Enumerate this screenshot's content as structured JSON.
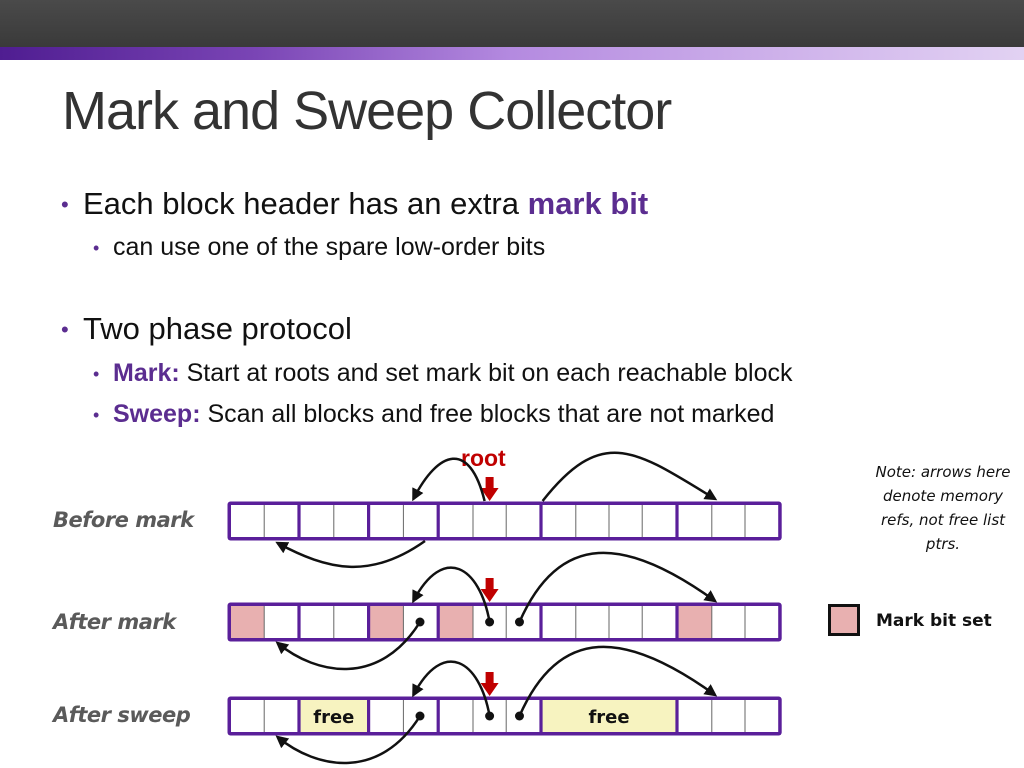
{
  "slide": {
    "title": "Mark and Sweep Collector",
    "bullets": [
      {
        "level": 1,
        "parts": [
          {
            "text": "Each block header has an extra ",
            "highlight": false
          },
          {
            "text": "mark bit",
            "highlight": true
          }
        ]
      },
      {
        "level": 2,
        "parts": [
          {
            "text": "can use one of the spare low-order bits",
            "highlight": false
          }
        ]
      },
      {
        "level": 1,
        "parts": [
          {
            "text": "Two phase protocol",
            "highlight": false
          }
        ]
      },
      {
        "level": 2,
        "parts": [
          {
            "text": "Mark:",
            "highlight": true
          },
          {
            "text": " Start at roots and set mark bit on each reachable block",
            "highlight": false
          }
        ]
      },
      {
        "level": 2,
        "parts": [
          {
            "text": "Sweep:",
            "highlight": true
          },
          {
            "text": " Scan all blocks and free blocks that are not marked",
            "highlight": false
          }
        ]
      }
    ],
    "bullet_glyph": "•"
  },
  "diagram": {
    "root_label": "root",
    "note": "Note: arrows here denote memory refs, not free list ptrs.",
    "legend": {
      "label": "Mark bit set",
      "swatch_color": "#e8b0b0"
    },
    "colors": {
      "block_border": "#5a1f9a",
      "marked": "#e8b0b0",
      "free": "#f7f3c0",
      "root_arrow": "#c00000",
      "ref_arrow": "#111111"
    },
    "block_sizes": [
      2,
      2,
      2,
      3,
      4,
      3
    ],
    "rows": [
      {
        "label": "Before mark",
        "blocks": [
          {
            "marked": false,
            "free": false
          },
          {
            "marked": false,
            "free": false
          },
          {
            "marked": false,
            "free": false
          },
          {
            "marked": false,
            "free": false
          },
          {
            "marked": false,
            "free": false
          },
          {
            "marked": false,
            "free": false
          }
        ],
        "show_root_label": true,
        "show_pointer_dots": false
      },
      {
        "label": "After mark",
        "blocks": [
          {
            "marked": true,
            "free": false
          },
          {
            "marked": false,
            "free": false
          },
          {
            "marked": true,
            "free": false
          },
          {
            "marked": true,
            "free": false
          },
          {
            "marked": false,
            "free": false
          },
          {
            "marked": true,
            "free": false
          }
        ],
        "show_root_label": false,
        "show_pointer_dots": true
      },
      {
        "label": "After sweep",
        "blocks": [
          {
            "marked": false,
            "free": false
          },
          {
            "marked": false,
            "free": true,
            "free_label": "free"
          },
          {
            "marked": false,
            "free": false
          },
          {
            "marked": false,
            "free": false
          },
          {
            "marked": false,
            "free": true,
            "free_label": "free"
          },
          {
            "marked": false,
            "free": false
          }
        ],
        "show_root_label": false,
        "show_pointer_dots": true
      }
    ]
  }
}
